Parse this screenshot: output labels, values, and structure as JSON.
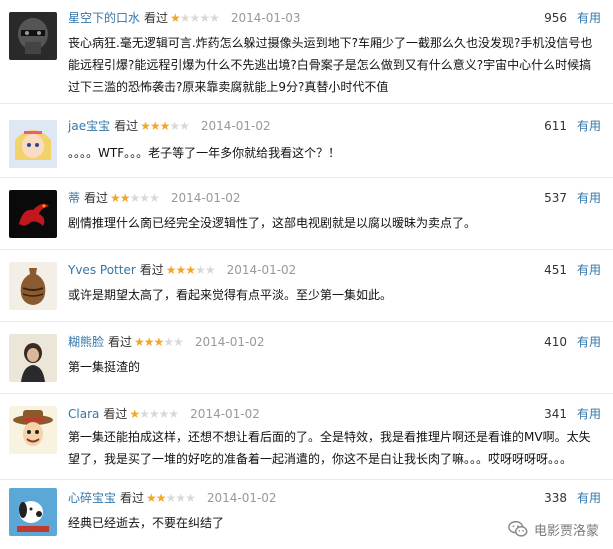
{
  "seen_label": "看过",
  "useful_label": "有用",
  "colors": {
    "username": "#3377aa",
    "star_on": "#f5a623",
    "star_off": "#d9d9d9",
    "date": "#999999"
  },
  "reviews": [
    {
      "user": "星空下的口水",
      "stars": 1,
      "date": "2014-01-03",
      "votes": "956",
      "avatar_icon": "dark-helmet-avatar-icon",
      "text": "丧心病狂.毫无逻辑可言.炸药怎么躲过摄像头运到地下?车厢少了一截那么久也没发现?手机没信号也能远程引爆?能远程引爆为什么不先逃出境?白骨案子是怎么做到又有什么意义?宇宙中心什么时候搞过下三滥的恐怖袭击?原来靠卖腐就能上9分?真替小时代不值"
    },
    {
      "user": "jae宝宝",
      "stars": 3,
      "date": "2014-01-02",
      "votes": "611",
      "avatar_icon": "anime-girl-avatar-icon",
      "text": "。。。。WTF。。。老子等了一年多你就给我看这个？！"
    },
    {
      "user": "蒂",
      "stars": 2,
      "date": "2014-01-02",
      "votes": "537",
      "avatar_icon": "red-dragon-avatar-icon",
      "text": "剧情推理什么啇已经完全没逻辑性了，这部电视剧就是以腐以暧昧为卖点了。"
    },
    {
      "user": "Yves Potter",
      "stars": 3,
      "date": "2014-01-02",
      "votes": "451",
      "avatar_icon": "vase-avatar-icon",
      "text": "或许是期望太高了，看起来觉得有点平淡。至少第一集如此。"
    },
    {
      "user": "糊熊脸",
      "stars": 3,
      "date": "2014-01-02",
      "votes": "410",
      "avatar_icon": "woman-portrait-avatar-icon",
      "text": "第一集挺渣的"
    },
    {
      "user": "Clara",
      "stars": 1,
      "date": "2014-01-02",
      "votes": "341",
      "avatar_icon": "cowboy-toy-avatar-icon",
      "text": "第一集还能拍成这样，还想不想让看后面的了。全是特效，我是看推理片啊还是看谁的MV啊。太失望了，我是买了一堆的好吃的准备着一起消遣的，你这不是白让我长肉了嘛。。。哎呀呀呀呀。。。"
    },
    {
      "user": "心碎宝宝",
      "stars": 2,
      "date": "2014-01-02",
      "votes": "338",
      "avatar_icon": "snoopy-avatar-icon",
      "text": "经典已经逝去，不要在纠结了"
    }
  ],
  "watermark": {
    "icon": "wechat-icon",
    "text": "电影贾洛蒙"
  }
}
